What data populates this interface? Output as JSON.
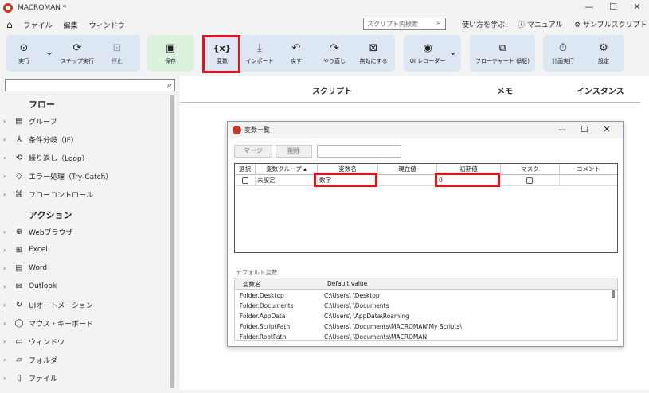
{
  "window": {
    "title": "MACROMAN *",
    "controls": [
      "—",
      "☐",
      "✕"
    ]
  },
  "menu": {
    "items": [
      "ファイル",
      "編集",
      "ウィンドウ"
    ]
  },
  "header": {
    "search_placeholder": "スクリプト内検索",
    "learn_label": "使い方を学ぶ:",
    "manual_label": "マニュアル",
    "sample_label": "サンプルスクリプト"
  },
  "toolbar": {
    "run": "実行",
    "step_run": "ステップ実行",
    "stop": "停止",
    "save": "保存",
    "variables_icon": "{x}",
    "variables": "変数",
    "import": "インポート",
    "back": "戻す",
    "redo": "やり直し",
    "disable": "無効にする",
    "ui_recorder": "UI レコーダー",
    "flowchart": "フローチャート (β版)",
    "scheduled_run": "計画実行",
    "settings": "設定"
  },
  "sidebar": {
    "flow_heading": "フロー",
    "flow_items": [
      "グループ",
      "条件分岐（IF）",
      "繰り返し（Loop）",
      "エラー処理（Try-Catch）",
      "フローコントロール"
    ],
    "action_heading": "アクション",
    "action_items": [
      "Webブラウザ",
      "Excel",
      "Word",
      "Outlook",
      "UIオートメーション",
      "マウス・キーボード",
      "ウィンドウ",
      "フォルダ",
      "ファイル"
    ]
  },
  "main": {
    "col_script": "スクリプト",
    "col_memo": "メモ",
    "col_instance": "インスタンス"
  },
  "dialog": {
    "title": "変数一覧",
    "merge": "マージ",
    "delete": "削除",
    "columns": [
      "選択",
      "変数グループ",
      "変数名",
      "現在値",
      "初期値",
      "マスク",
      "コメント"
    ],
    "row": {
      "group": "未設定",
      "name": "数字",
      "current": "",
      "initial": "0"
    },
    "default_label": "デフォルト変数",
    "default_columns": [
      "変数名",
      "Default value"
    ],
    "default_rows": [
      {
        "name": "Folder.Desktop",
        "value": "C:\\Users\\      \\Desktop"
      },
      {
        "name": "Folder.Documents",
        "value": "C:\\Users\\      \\Documents"
      },
      {
        "name": "Folder.AppData",
        "value": "C:\\Users\\      \\AppData\\Roaming"
      },
      {
        "name": "Folder.ScriptPath",
        "value": "C:\\Users\\      \\Documents\\MACROMAN\\My Scripts\\"
      },
      {
        "name": "Folder.RootPath",
        "value": "C:\\Users\\      \\Documents\\MACROMAN"
      }
    ]
  },
  "colors": {
    "highlight": "#e0141e",
    "toolbar_group": "#dde7f4",
    "save_group": "#dbf2de",
    "logo": "#c0392b"
  }
}
